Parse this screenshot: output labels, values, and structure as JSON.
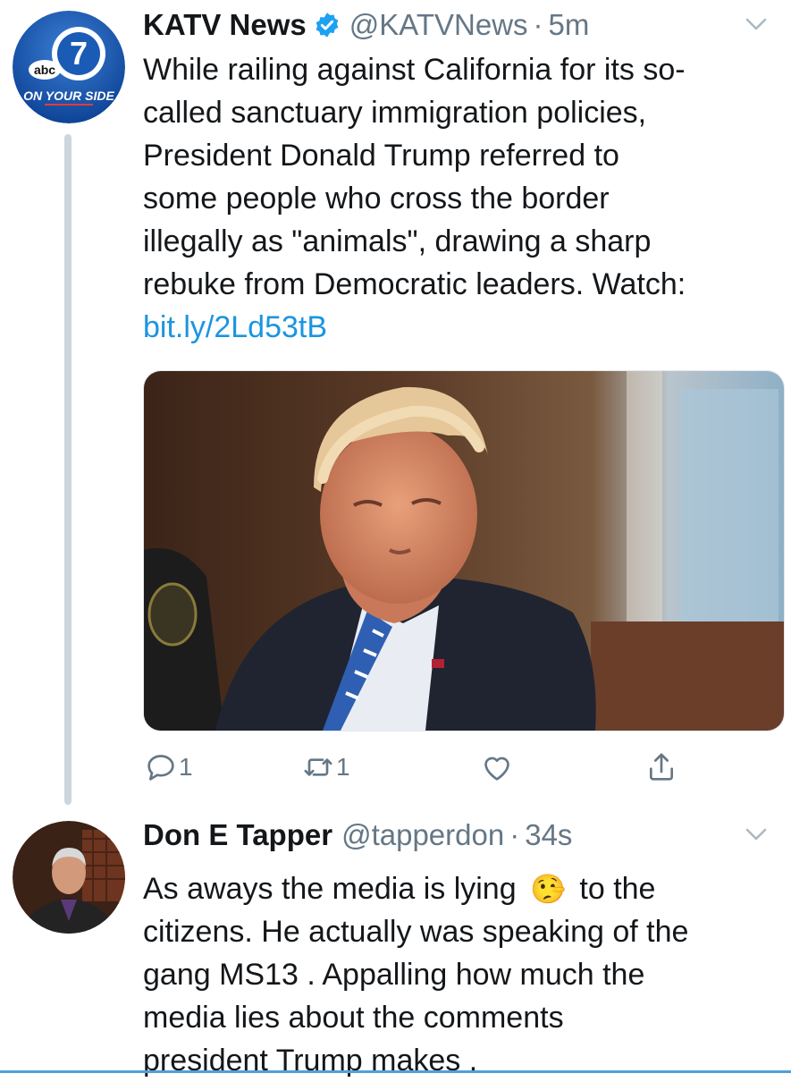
{
  "tweets": [
    {
      "name": "KATV News",
      "handle": "@KATVNews",
      "separator": "·",
      "time": "5m",
      "avatar_text": {
        "logo": "abc",
        "number": "7",
        "tagline": "ON YOUR SIDE"
      },
      "text_lines": [
        "While railing against California for its so-",
        "called sanctuary immigration policies,",
        "President Donald Trump referred to",
        "some people who cross the border",
        "illegally as \"animals\", drawing a sharp",
        "rebuke from Democratic leaders. Watch:"
      ],
      "link": "bit.ly/2Ld53tB",
      "reply_count": "1",
      "retweet_count": "1"
    },
    {
      "name": "Don E Tapper",
      "handle": "@tapperdon",
      "separator": "·",
      "time": "34s",
      "text_lines": [
        "As aways the media is lying",
        "to the",
        "citizens. He actually was speaking of the",
        "gang MS13 . Appalling how much the",
        "media lies about the comments",
        "president Trump makes ."
      ],
      "emoji": "🤥"
    }
  ],
  "colors": {
    "link": "#1b95e0",
    "secondary": "#657786",
    "verified": "#1da1f2"
  }
}
